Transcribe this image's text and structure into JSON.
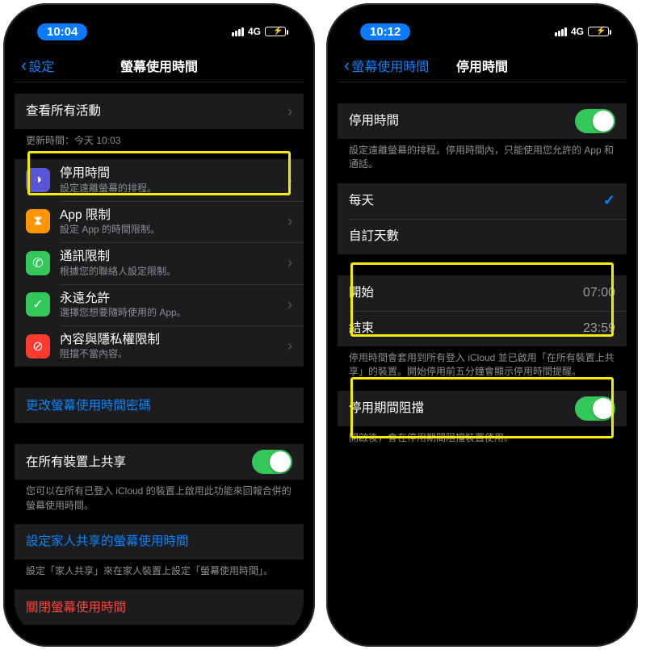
{
  "left": {
    "status_time": "10:04",
    "carrier": "4G",
    "back_label": "設定",
    "title": "螢幕使用時間",
    "see_all_activity": "查看所有活動",
    "update_time": "更新時間：今天 10:03",
    "rows": [
      {
        "icon_bg": "#5856d6",
        "glyph": "◑",
        "title": "停用時間",
        "sub": "設定遠離螢幕的排程。"
      },
      {
        "icon_bg": "#ff9500",
        "glyph": "⧗",
        "title": "App 限制",
        "sub": "設定 App 的時間限制。"
      },
      {
        "icon_bg": "#34c759",
        "glyph": "✆",
        "title": "通訊限制",
        "sub": "根據您的聯絡人設定限制。"
      },
      {
        "icon_bg": "#34c759",
        "glyph": "✓",
        "title": "永遠允許",
        "sub": "選擇您想要隨時使用的 App。"
      },
      {
        "icon_bg": "#ff3b30",
        "glyph": "⊘",
        "title": "內容與隱私權限制",
        "sub": "阻擋不當內容。"
      }
    ],
    "change_passcode": "更改螢幕使用時間密碼",
    "share_all_devices": "在所有裝置上共享",
    "share_footer": "您可以在所有已登入 iCloud 的裝置上啟用此功能來回報合併的螢幕使用時間。",
    "family_setup": "設定家人共享的螢幕使用時間",
    "family_footer": "設定「家人共享」來在家人裝置上設定「螢幕使用時間」。",
    "turn_off": "關閉螢幕使用時間"
  },
  "right": {
    "status_time": "10:12",
    "carrier": "4G",
    "back_label": "螢幕使用時間",
    "title": "停用時間",
    "downtime_label": "停用時間",
    "downtime_footer": "設定遠離螢幕的排程。停用時間內，只能使用您允許的 App 和通話。",
    "every_day": "每天",
    "custom_days": "自訂天數",
    "start_label": "開始",
    "start_value": "07:00",
    "end_label": "結束",
    "end_value": "23:59",
    "time_footer": "停用時間會套用到所有登入 iCloud 並已啟用「在所有裝置上共享」的裝置。開始停用前五分鐘會顯示停用時間提醒。",
    "block_label": "停用期間阻擋",
    "block_footer": "開啟後，會在停用期間阻擋裝置使用。"
  }
}
